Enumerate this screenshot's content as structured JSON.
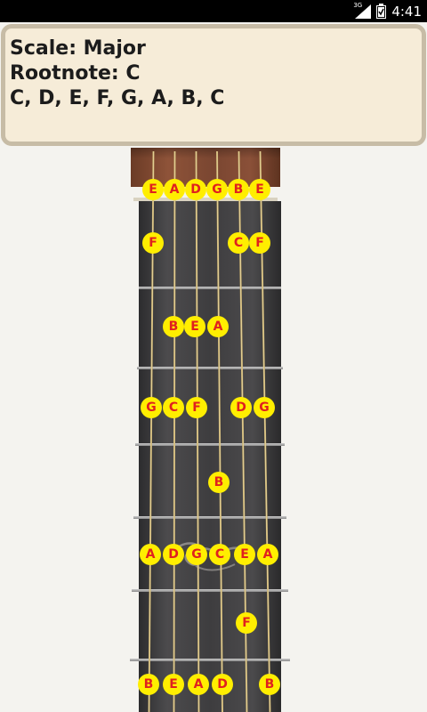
{
  "status_bar": {
    "network": "3G",
    "time": "4:41"
  },
  "info": {
    "scale_line": "Scale: Major",
    "root_line": "Rootnote: C",
    "notes_line": "C, D, E, F, G, A, B, C"
  },
  "colors": {
    "note_fill": "#ffee00",
    "note_text": "#e0201f",
    "panel": "#f6ecd8",
    "panel_border": "#c7bca6"
  },
  "strings": [
    "E",
    "A",
    "D",
    "G",
    "B",
    "E"
  ],
  "fretboard_notes": [
    {
      "string": 1,
      "fret": 0,
      "note": "E"
    },
    {
      "string": 2,
      "fret": 0,
      "note": "A"
    },
    {
      "string": 3,
      "fret": 0,
      "note": "D"
    },
    {
      "string": 4,
      "fret": 0,
      "note": "G"
    },
    {
      "string": 5,
      "fret": 0,
      "note": "B"
    },
    {
      "string": 6,
      "fret": 0,
      "note": "E"
    },
    {
      "string": 1,
      "fret": 1,
      "note": "F"
    },
    {
      "string": 5,
      "fret": 1,
      "note": "C"
    },
    {
      "string": 6,
      "fret": 1,
      "note": "F"
    },
    {
      "string": 2,
      "fret": 2,
      "note": "B"
    },
    {
      "string": 3,
      "fret": 2,
      "note": "E"
    },
    {
      "string": 4,
      "fret": 2,
      "note": "A"
    },
    {
      "string": 1,
      "fret": 3,
      "note": "G"
    },
    {
      "string": 2,
      "fret": 3,
      "note": "C"
    },
    {
      "string": 3,
      "fret": 3,
      "note": "F"
    },
    {
      "string": 5,
      "fret": 3,
      "note": "D"
    },
    {
      "string": 6,
      "fret": 3,
      "note": "G"
    },
    {
      "string": 4,
      "fret": 4,
      "note": "B"
    },
    {
      "string": 1,
      "fret": 5,
      "note": "A"
    },
    {
      "string": 2,
      "fret": 5,
      "note": "D"
    },
    {
      "string": 3,
      "fret": 5,
      "note": "G"
    },
    {
      "string": 4,
      "fret": 5,
      "note": "C"
    },
    {
      "string": 5,
      "fret": 5,
      "note": "E"
    },
    {
      "string": 6,
      "fret": 5,
      "note": "A"
    },
    {
      "string": 5,
      "fret": 6,
      "note": "F"
    },
    {
      "string": 1,
      "fret": 7,
      "note": "B"
    },
    {
      "string": 2,
      "fret": 7,
      "note": "E"
    },
    {
      "string": 3,
      "fret": 7,
      "note": "A"
    },
    {
      "string": 4,
      "fret": 7,
      "note": "D"
    },
    {
      "string": 6,
      "fret": 7,
      "note": "B"
    }
  ]
}
